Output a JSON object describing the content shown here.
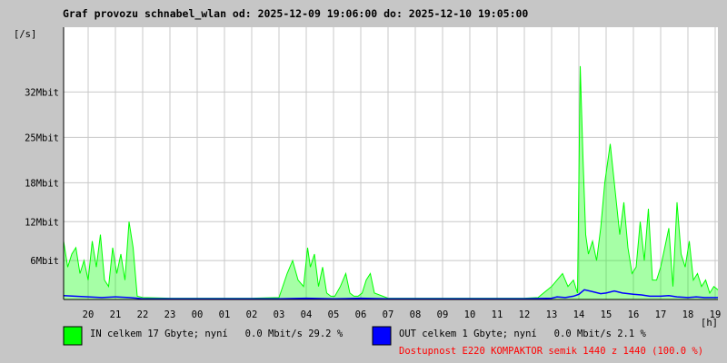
{
  "colors": {
    "background": "#c6c6c6",
    "plot_background": "#ffffff",
    "grid": "#c8c8c8",
    "in_series": "#00ff00",
    "out_series": "#0000ff",
    "availability_text": "#ff0000",
    "text": "#000000"
  },
  "chart_data": {
    "type": "area",
    "title": "Graf provozu schnabel_wlan od: 2025-12-09 19:06:00 do: 2025-12-10 19:05:00",
    "ylabel": "[/s]",
    "xlabel": "[h]",
    "ylim": [
      0,
      42
    ],
    "xlim": [
      19.1,
      43.1
    ],
    "y_ticks": [
      {
        "value": 6,
        "label": "6Mbit"
      },
      {
        "value": 12,
        "label": "12Mbit"
      },
      {
        "value": 18,
        "label": "18Mbit"
      },
      {
        "value": 25,
        "label": "25Mbit"
      },
      {
        "value": 32,
        "label": "32Mbit"
      }
    ],
    "x_ticks": [
      {
        "value": 20,
        "label": "20"
      },
      {
        "value": 21,
        "label": "21"
      },
      {
        "value": 22,
        "label": "22"
      },
      {
        "value": 23,
        "label": "23"
      },
      {
        "value": 24,
        "label": "00"
      },
      {
        "value": 25,
        "label": "01"
      },
      {
        "value": 26,
        "label": "02"
      },
      {
        "value": 27,
        "label": "03"
      },
      {
        "value": 28,
        "label": "04"
      },
      {
        "value": 29,
        "label": "05"
      },
      {
        "value": 30,
        "label": "06"
      },
      {
        "value": 31,
        "label": "07"
      },
      {
        "value": 32,
        "label": "08"
      },
      {
        "value": 33,
        "label": "09"
      },
      {
        "value": 34,
        "label": "10"
      },
      {
        "value": 35,
        "label": "11"
      },
      {
        "value": 36,
        "label": "12"
      },
      {
        "value": 37,
        "label": "13"
      },
      {
        "value": 38,
        "label": "14"
      },
      {
        "value": 39,
        "label": "15"
      },
      {
        "value": 40,
        "label": "16"
      },
      {
        "value": 41,
        "label": "17"
      },
      {
        "value": 42,
        "label": "18"
      },
      {
        "value": 43,
        "label": "19"
      }
    ],
    "grid": true,
    "series": [
      {
        "color": "#00ff00",
        "x": [
          19.1,
          19.25,
          19.4,
          19.55,
          19.7,
          19.85,
          20.0,
          20.15,
          20.3,
          20.45,
          20.6,
          20.75,
          20.9,
          21.05,
          21.2,
          21.35,
          21.5,
          21.65,
          21.8,
          22.0,
          23.0,
          24.0,
          25.0,
          26.0,
          27.0,
          27.3,
          27.5,
          27.7,
          27.9,
          28.05,
          28.15,
          28.3,
          28.45,
          28.6,
          28.75,
          28.9,
          29.05,
          29.25,
          29.45,
          29.6,
          29.75,
          29.9,
          30.05,
          30.2,
          30.35,
          30.5,
          31.0,
          32.0,
          33.0,
          34.0,
          35.0,
          36.0,
          36.5,
          37.0,
          37.2,
          37.4,
          37.6,
          37.8,
          37.95,
          38.05,
          38.15,
          38.25,
          38.35,
          38.5,
          38.65,
          38.8,
          38.95,
          39.05,
          39.15,
          39.25,
          39.35,
          39.5,
          39.65,
          39.8,
          39.95,
          40.1,
          40.25,
          40.4,
          40.55,
          40.7,
          40.85,
          41.0,
          41.15,
          41.3,
          41.45,
          41.6,
          41.75,
          41.9,
          42.05,
          42.2,
          42.35,
          42.5,
          42.65,
          42.8,
          42.95,
          43.1
        ],
        "values": [
          9,
          5,
          7,
          8,
          4,
          6,
          3,
          9,
          5,
          10,
          3,
          2,
          8,
          4,
          7,
          3,
          12,
          8,
          0.5,
          0.3,
          0.2,
          0.2,
          0.2,
          0.2,
          0.3,
          4,
          6,
          3,
          2,
          8,
          5,
          7,
          2,
          5,
          1,
          0.5,
          0.5,
          2,
          4,
          1,
          0.5,
          0.5,
          1,
          3,
          4,
          1,
          0.2,
          0.2,
          0.2,
          0.2,
          0.2,
          0.2,
          0.3,
          2,
          3,
          4,
          2,
          3,
          1,
          36,
          22,
          10,
          7,
          9,
          6,
          11,
          18,
          21,
          24,
          20,
          16,
          10,
          15,
          8,
          4,
          5,
          12,
          6,
          14,
          3,
          3,
          5,
          8,
          11,
          2,
          15,
          7,
          5,
          9,
          3,
          4,
          2,
          3,
          1,
          2,
          1.5
        ]
      },
      {
        "color": "#0000ff",
        "x": [
          19.1,
          19.5,
          20.0,
          20.5,
          21.0,
          21.5,
          21.8,
          22.0,
          23.0,
          24.0,
          25.0,
          26.0,
          27.0,
          28.0,
          29.0,
          30.0,
          31.0,
          32.0,
          33.0,
          34.0,
          35.0,
          36.0,
          37.0,
          37.2,
          37.5,
          37.8,
          38.0,
          38.2,
          38.5,
          38.8,
          39.0,
          39.3,
          39.6,
          40.0,
          40.3,
          40.6,
          41.0,
          41.3,
          41.6,
          42.0,
          42.3,
          42.6,
          43.1
        ],
        "values": [
          0.6,
          0.5,
          0.4,
          0.3,
          0.4,
          0.3,
          0.2,
          0.1,
          0.1,
          0.1,
          0.1,
          0.1,
          0.1,
          0.2,
          0.1,
          0.2,
          0.1,
          0.1,
          0.1,
          0.1,
          0.1,
          0.1,
          0.2,
          0.4,
          0.3,
          0.5,
          0.8,
          1.5,
          1.2,
          0.9,
          1.0,
          1.3,
          1.0,
          0.8,
          0.7,
          0.5,
          0.5,
          0.6,
          0.4,
          0.3,
          0.4,
          0.3,
          0.3
        ]
      }
    ]
  },
  "legend": {
    "in_text": "IN celkem 17 Gbyte; nyní   0.0 Mbit/s 29.2 %",
    "out_text": "OUT celkem 1 Gbyte; nyní   0.0 Mbit/s 2.1 %",
    "availability_text": "Dostupnost E220 KOMPAKTOR semik 1440 z 1440 (100.0 %)"
  }
}
